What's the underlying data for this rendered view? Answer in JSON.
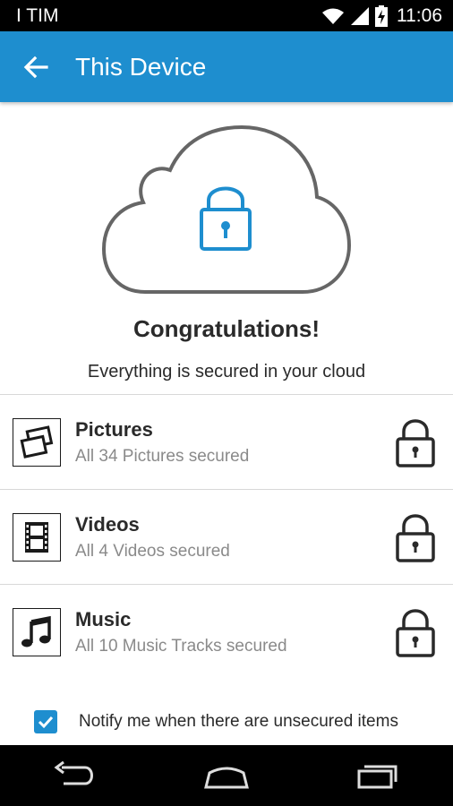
{
  "status_bar": {
    "carrier": "I TIM",
    "time": "11:06",
    "icons": [
      "wifi-icon",
      "signal-icon",
      "battery-charging-icon"
    ]
  },
  "app_bar": {
    "title": "This Device",
    "back_icon": "arrow-left-icon",
    "color": "#1e8ecf"
  },
  "hero": {
    "icon": "cloud-lock-icon",
    "heading": "Congratulations!",
    "subheading": "Everything is secured in your cloud"
  },
  "items": [
    {
      "name": "Pictures",
      "detail": "All 34 Pictures secured",
      "icon": "pictures-icon",
      "status_icon": "lock-icon"
    },
    {
      "name": "Videos",
      "detail": "All 4 Videos secured",
      "icon": "film-icon",
      "status_icon": "lock-icon"
    },
    {
      "name": "Music",
      "detail": "All 10 Music Tracks secured",
      "icon": "music-note-icon",
      "status_icon": "lock-icon"
    }
  ],
  "notify": {
    "label": "Notify me when there are unsecured items",
    "checked": true
  },
  "nav_bar": {
    "icons": [
      "back-nav-icon",
      "home-nav-icon",
      "recents-nav-icon"
    ]
  }
}
